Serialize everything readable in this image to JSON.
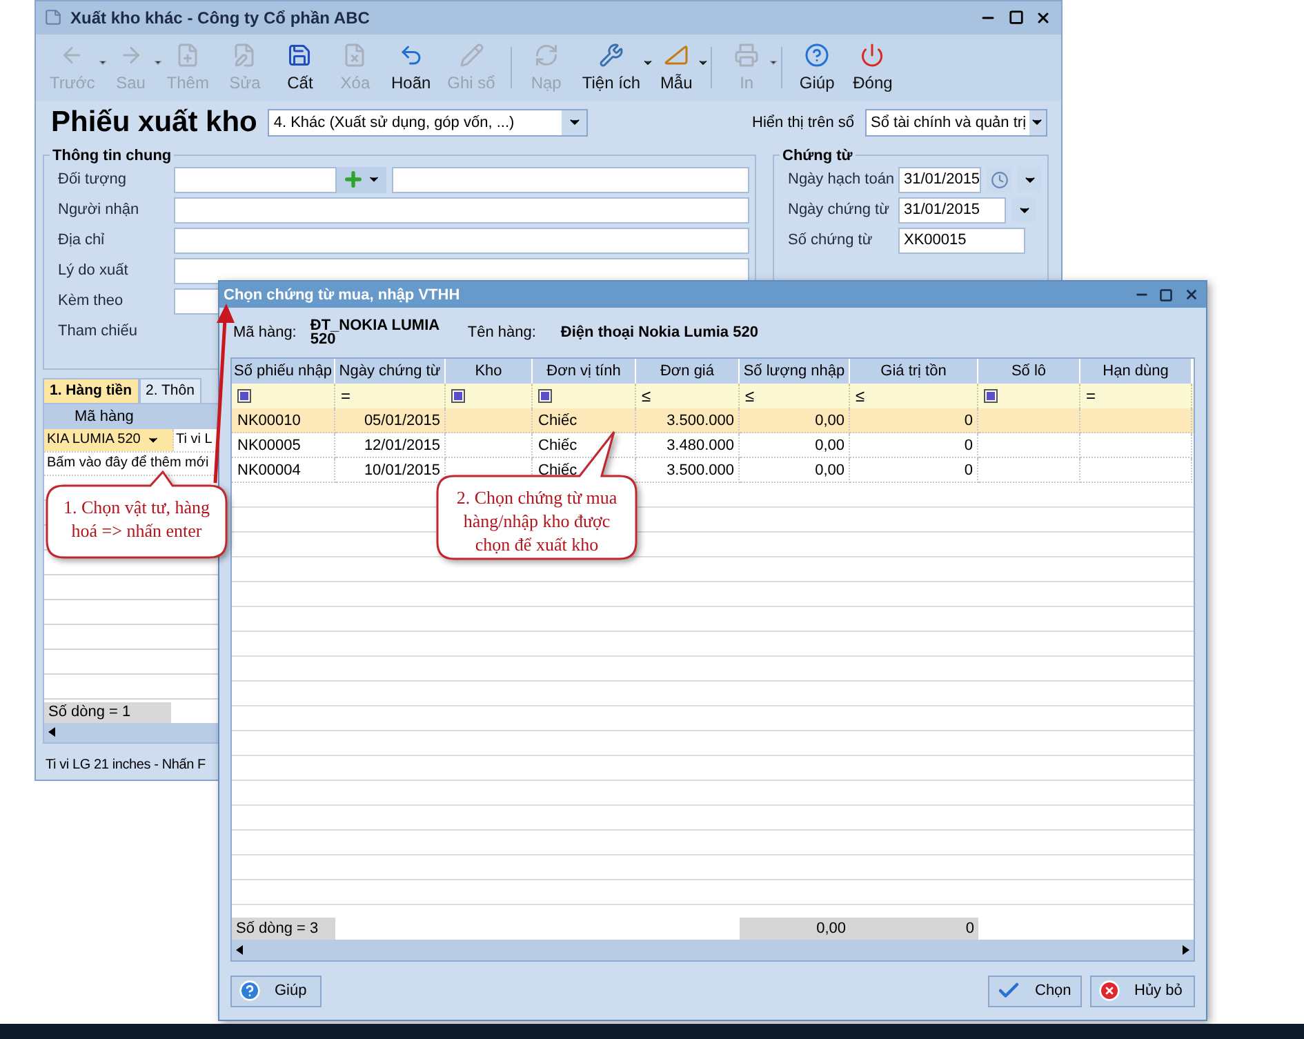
{
  "main_window": {
    "title": "Xuất kho khác - Công ty Cổ phần ABC",
    "toolbar": [
      {
        "label": "Trước",
        "disabled": true,
        "dropdown": true
      },
      {
        "label": "Sau",
        "disabled": true,
        "dropdown": true
      },
      {
        "label": "Thêm",
        "disabled": true,
        "dropdown": false
      },
      {
        "label": "Sửa",
        "disabled": true,
        "dropdown": false
      },
      {
        "label": "Cất",
        "disabled": false,
        "dropdown": false
      },
      {
        "label": "Xóa",
        "disabled": true,
        "dropdown": false
      },
      {
        "label": "Hoãn",
        "disabled": false,
        "dropdown": false
      },
      {
        "label": "Ghi sổ",
        "disabled": true,
        "dropdown": false
      },
      {
        "label": "Nạp",
        "disabled": true,
        "dropdown": false
      },
      {
        "label": "Tiện ích",
        "disabled": false,
        "dropdown": true
      },
      {
        "label": "Mẫu",
        "disabled": false,
        "dropdown": true
      },
      {
        "label": "In",
        "disabled": true,
        "dropdown": true
      },
      {
        "label": "Giúp",
        "disabled": false,
        "dropdown": false
      },
      {
        "label": "Đóng",
        "disabled": false,
        "dropdown": false
      }
    ],
    "voucher_title": "Phiếu xuất kho",
    "voucher_type": "4. Khác (Xuất sử dụng, góp vốn, ...)",
    "ledger_label": "Hiển thị trên sổ",
    "ledger_value": "Sổ tài chính và quản trị",
    "general_info": {
      "title": "Thông tin chung",
      "fields": [
        {
          "label": "Đối tượng",
          "kind": "lookup"
        },
        {
          "label": "Người nhận",
          "kind": "text"
        },
        {
          "label": "Địa chỉ",
          "kind": "text"
        },
        {
          "label": "Lý do xuất",
          "kind": "text"
        },
        {
          "label": "Kèm theo",
          "kind": "text"
        },
        {
          "label": "Tham chiếu",
          "kind": "plain"
        }
      ]
    },
    "voucher": {
      "title": "Chứng từ",
      "fields": [
        {
          "label": "Ngày hạch toán",
          "value": "31/01/2015",
          "kind": "date_clock"
        },
        {
          "label": "Ngày chứng từ",
          "value": "31/01/2015",
          "kind": "date"
        },
        {
          "label": "Số chứng từ",
          "value": "XK00015",
          "kind": "text"
        }
      ]
    },
    "tabs": [
      {
        "label": "1. Hàng tiền",
        "selected": true
      },
      {
        "label": "2. Thôn",
        "selected": false
      }
    ],
    "grid": {
      "columns": [
        "Mã hàng"
      ],
      "rows": [
        [
          "KIA LUMIA 520",
          "Ti vi L"
        ]
      ],
      "new_row_hint": "Bấm vào đây để thêm mới",
      "footer": "Số dòng = 1"
    },
    "status_bar": "Ti vi LG 21 inches - Nhấn F"
  },
  "dialog": {
    "title": "Chọn chứng từ mua, nhập VTHH",
    "item_code_label": "Mã hàng:",
    "item_code": "ĐT_NOKIA LUMIA 520",
    "item_name_label": "Tên hàng:",
    "item_name": "Điện thoại Nokia Lumia 520",
    "columns": [
      "Số phiếu nhập",
      "Ngày chứng từ",
      "Kho",
      "Đơn vị tính",
      "Đơn giá",
      "Số lượng nhập",
      "Giá trị tồn",
      "Số lô",
      "Hạn dùng"
    ],
    "filters": [
      {
        "kind": "icon"
      },
      {
        "kind": "text",
        "text": "="
      },
      {
        "kind": "icon"
      },
      {
        "kind": "icon"
      },
      {
        "kind": "text",
        "text": "≤"
      },
      {
        "kind": "text",
        "text": "≤"
      },
      {
        "kind": "text",
        "text": "≤"
      },
      {
        "kind": "icon"
      },
      {
        "kind": "text",
        "text": "="
      }
    ],
    "rows": [
      {
        "number": "NK00010",
        "date": "05/01/2015",
        "unit": "Chiếc",
        "price": "3.500.000",
        "quantity": "0,00",
        "stock_value": "0",
        "selected": true
      },
      {
        "number": "NK00005",
        "date": "12/01/2015",
        "unit": "Chiếc",
        "price": "3.480.000",
        "quantity": "0,00",
        "stock_value": "0",
        "selected": false
      },
      {
        "number": "NK00004",
        "date": "10/01/2015",
        "unit": "Chiếc",
        "price": "3.500.000",
        "quantity": "0,00",
        "stock_value": "0",
        "selected": false
      }
    ],
    "footer": {
      "count": "Số dòng = 3",
      "quantity": "0,00",
      "stock_value": "0"
    },
    "buttons": [
      {
        "label": "Giúp",
        "kind": "help"
      },
      {
        "label": "Chọn",
        "kind": "ok"
      },
      {
        "label": "Hủy bỏ",
        "kind": "cancel"
      }
    ]
  },
  "callouts": [
    {
      "text": "1. Chọn vật tư, hàng hoá => nhấn enter"
    },
    {
      "text": "2. Chọn chứng từ mua hàng/nhập kho được chọn để xuất kho"
    }
  ]
}
